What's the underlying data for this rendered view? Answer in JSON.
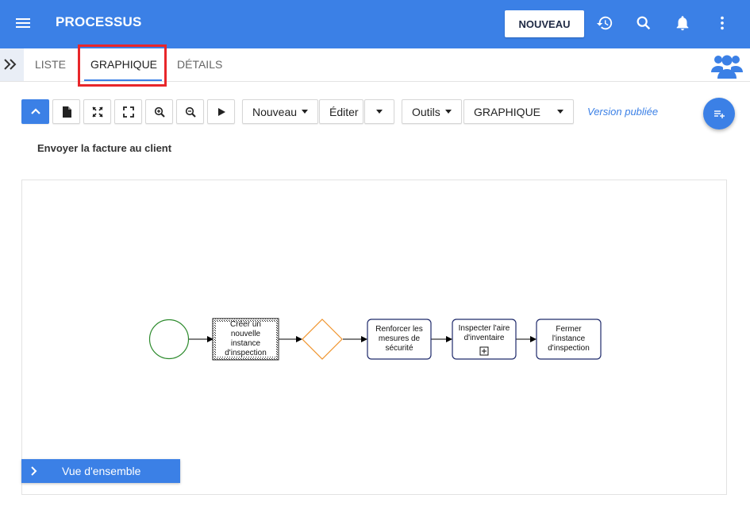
{
  "appbar": {
    "title": "PROCESSUS",
    "new_button": "NOUVEAU",
    "icons": [
      "menu-icon",
      "history-icon",
      "search-icon",
      "bell-icon",
      "more-vert-icon"
    ]
  },
  "tabs": [
    {
      "label": "LISTE",
      "active": false
    },
    {
      "label": "GRAPHIQUE",
      "active": true
    },
    {
      "label": "DÉTAILS",
      "active": false
    }
  ],
  "toolbar": {
    "icons": [
      "collapse-up-icon",
      "document-icon",
      "fit-arrows-icon",
      "fullscreen-icon",
      "zoom-in-icon",
      "zoom-out-icon",
      "play-icon"
    ],
    "nouveau": "Nouveau",
    "editer": "Éditer",
    "outils": "Outils",
    "view_select": "GRAPHIQUE",
    "version": "Version publiée"
  },
  "process": {
    "title": "Envoyer la facture au client"
  },
  "diagram": {
    "nodes": [
      {
        "type": "start-event",
        "label": ""
      },
      {
        "type": "task-selected",
        "label": "Créer un nouvelle instance d'inspection"
      },
      {
        "type": "gateway",
        "label": ""
      },
      {
        "type": "task",
        "label": "Renforcer les mesures de sécurité"
      },
      {
        "type": "subprocess",
        "label": "Inspecter l'aire d'inventaire"
      },
      {
        "type": "task",
        "label": "Fermer l'instance d'inspection"
      }
    ],
    "colors": {
      "start": "#2e8b2e",
      "gateway": "#f0932b",
      "task_border": "#1f2a6b",
      "arrow": "#000000"
    }
  },
  "overview": {
    "label": "Vue d'ensemble"
  },
  "colors": {
    "primary": "#3b80e6",
    "highlight": "#e8262a"
  }
}
